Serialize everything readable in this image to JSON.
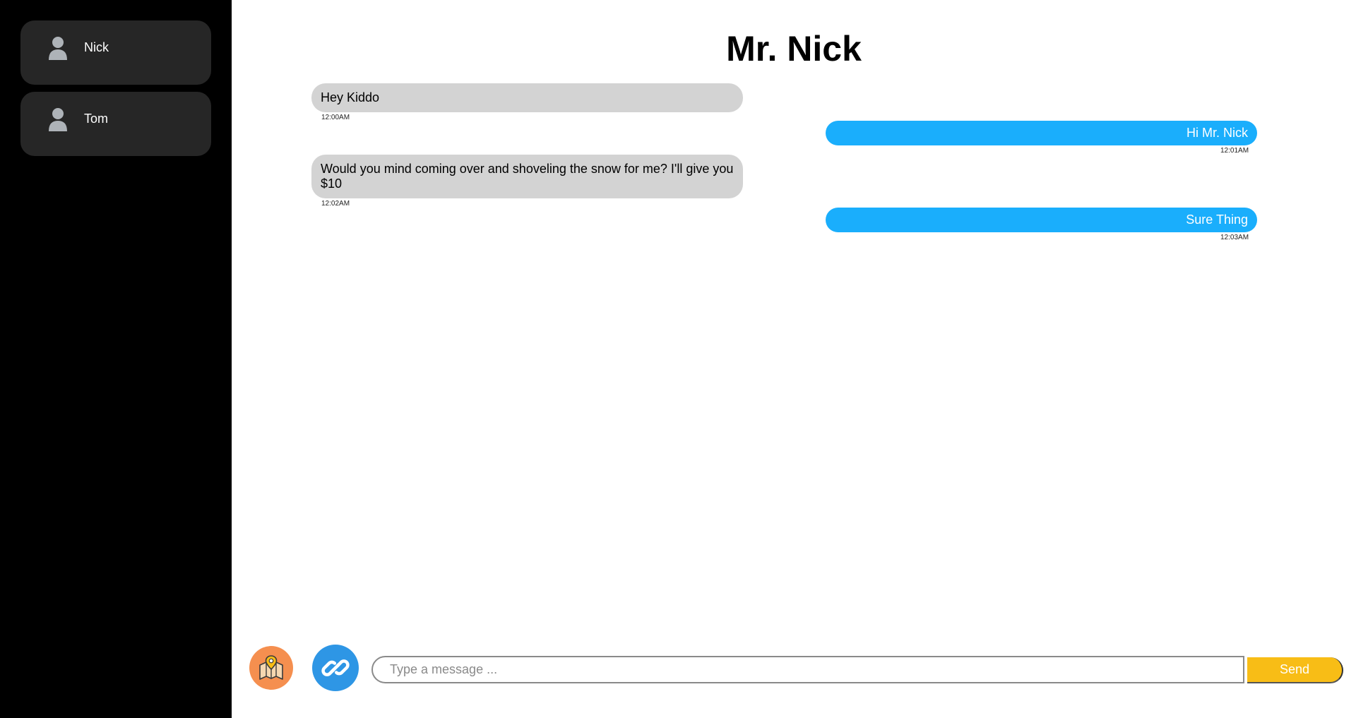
{
  "sidebar": {
    "contacts": [
      {
        "name": "Nick",
        "icon": "user-icon"
      },
      {
        "name": "Tom",
        "icon": "user-icon"
      }
    ]
  },
  "chat": {
    "title": "Mr. Nick",
    "messages": [
      {
        "direction": "incoming",
        "text": "Hey Kiddo",
        "time": "12:00AM"
      },
      {
        "direction": "outgoing",
        "text": "Hi Mr. Nick",
        "time": "12:01AM"
      },
      {
        "direction": "incoming",
        "text": "Would you mind coming over and shoveling the snow for me? I'll give you $10",
        "time": "12:02AM"
      },
      {
        "direction": "outgoing",
        "text": "Sure Thing",
        "time": "12:03AM"
      }
    ]
  },
  "composer": {
    "placeholder": "Type a message ...",
    "value": "",
    "send_label": "Send",
    "map_icon": "map-location-icon",
    "link_icon": "link-icon"
  },
  "colors": {
    "sidebar_bg": "#000000",
    "contact_bg": "#262626",
    "incoming_bubble": "#d3d3d3",
    "outgoing_bubble": "#1aaefc",
    "send_button": "#f8bd16",
    "map_button": "#f58f4f",
    "link_button": "#2e96e5"
  }
}
